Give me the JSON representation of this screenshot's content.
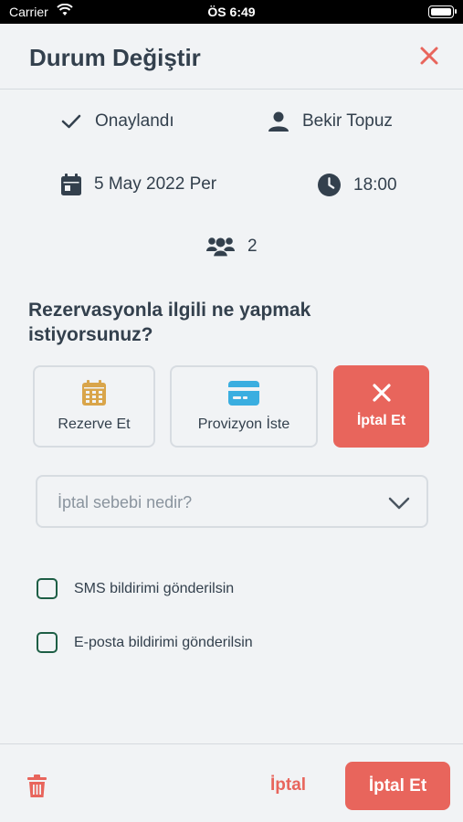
{
  "status_bar": {
    "carrier": "Carrier",
    "time": "ÖS 6:49"
  },
  "header": {
    "title": "Durum Değiştir"
  },
  "info": {
    "status": "Onaylandı",
    "guest_name": "Bekir Topuz",
    "date": "5 May 2022 Per",
    "time": "18:00",
    "party_size": "2"
  },
  "question": "Rezervasyonla ilgili ne yapmak istiyorsunuz?",
  "options": [
    {
      "label": "Rezerve Et",
      "icon": "calendar-icon",
      "selected": false
    },
    {
      "label": "Provizyon İste",
      "icon": "credit-card-icon",
      "selected": false
    },
    {
      "label": "İptal Et",
      "icon": "close-icon",
      "selected": true
    }
  ],
  "cancel_reason": {
    "placeholder": "İptal sebebi nedir?",
    "value": ""
  },
  "notifications": [
    {
      "label": "SMS bildirimi gönderilsin",
      "checked": false
    },
    {
      "label": "E-posta bildirimi gönderilsin",
      "checked": false
    }
  ],
  "footer": {
    "cancel_label": "İptal",
    "confirm_label": "İptal Et"
  },
  "colors": {
    "accent": "#e8655c",
    "text": "#33404d",
    "checkbox": "#1d5e45",
    "calendar_icon": "#d9a54a",
    "card_icon": "#3aaee0"
  }
}
